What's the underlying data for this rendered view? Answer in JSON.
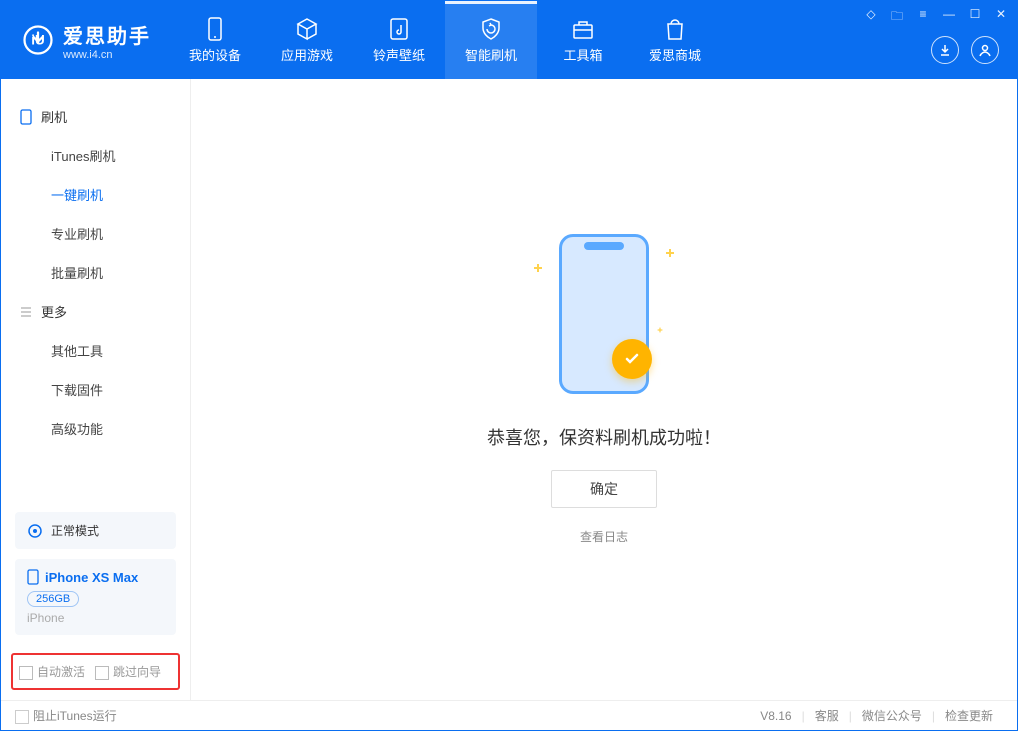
{
  "app": {
    "title": "爱思助手",
    "subtitle": "www.i4.cn"
  },
  "nav": {
    "items": [
      {
        "label": "我的设备"
      },
      {
        "label": "应用游戏"
      },
      {
        "label": "铃声壁纸"
      },
      {
        "label": "智能刷机"
      },
      {
        "label": "工具箱"
      },
      {
        "label": "爱思商城"
      }
    ]
  },
  "sidebar": {
    "section1_title": "刷机",
    "items1": [
      {
        "label": "iTunes刷机"
      },
      {
        "label": "一键刷机"
      },
      {
        "label": "专业刷机"
      },
      {
        "label": "批量刷机"
      }
    ],
    "section2_title": "更多",
    "items2": [
      {
        "label": "其他工具"
      },
      {
        "label": "下载固件"
      },
      {
        "label": "高级功能"
      }
    ]
  },
  "device": {
    "mode": "正常模式",
    "name": "iPhone XS Max",
    "capacity": "256GB",
    "type": "iPhone"
  },
  "options": {
    "auto_activate": "自动激活",
    "skip_guide": "跳过向导"
  },
  "main": {
    "success_text": "恭喜您，保资料刷机成功啦！",
    "ok_button": "确定",
    "view_log": "查看日志"
  },
  "footer": {
    "block_itunes": "阻止iTunes运行",
    "version": "V8.16",
    "support": "客服",
    "wechat": "微信公众号",
    "check_update": "检查更新"
  }
}
